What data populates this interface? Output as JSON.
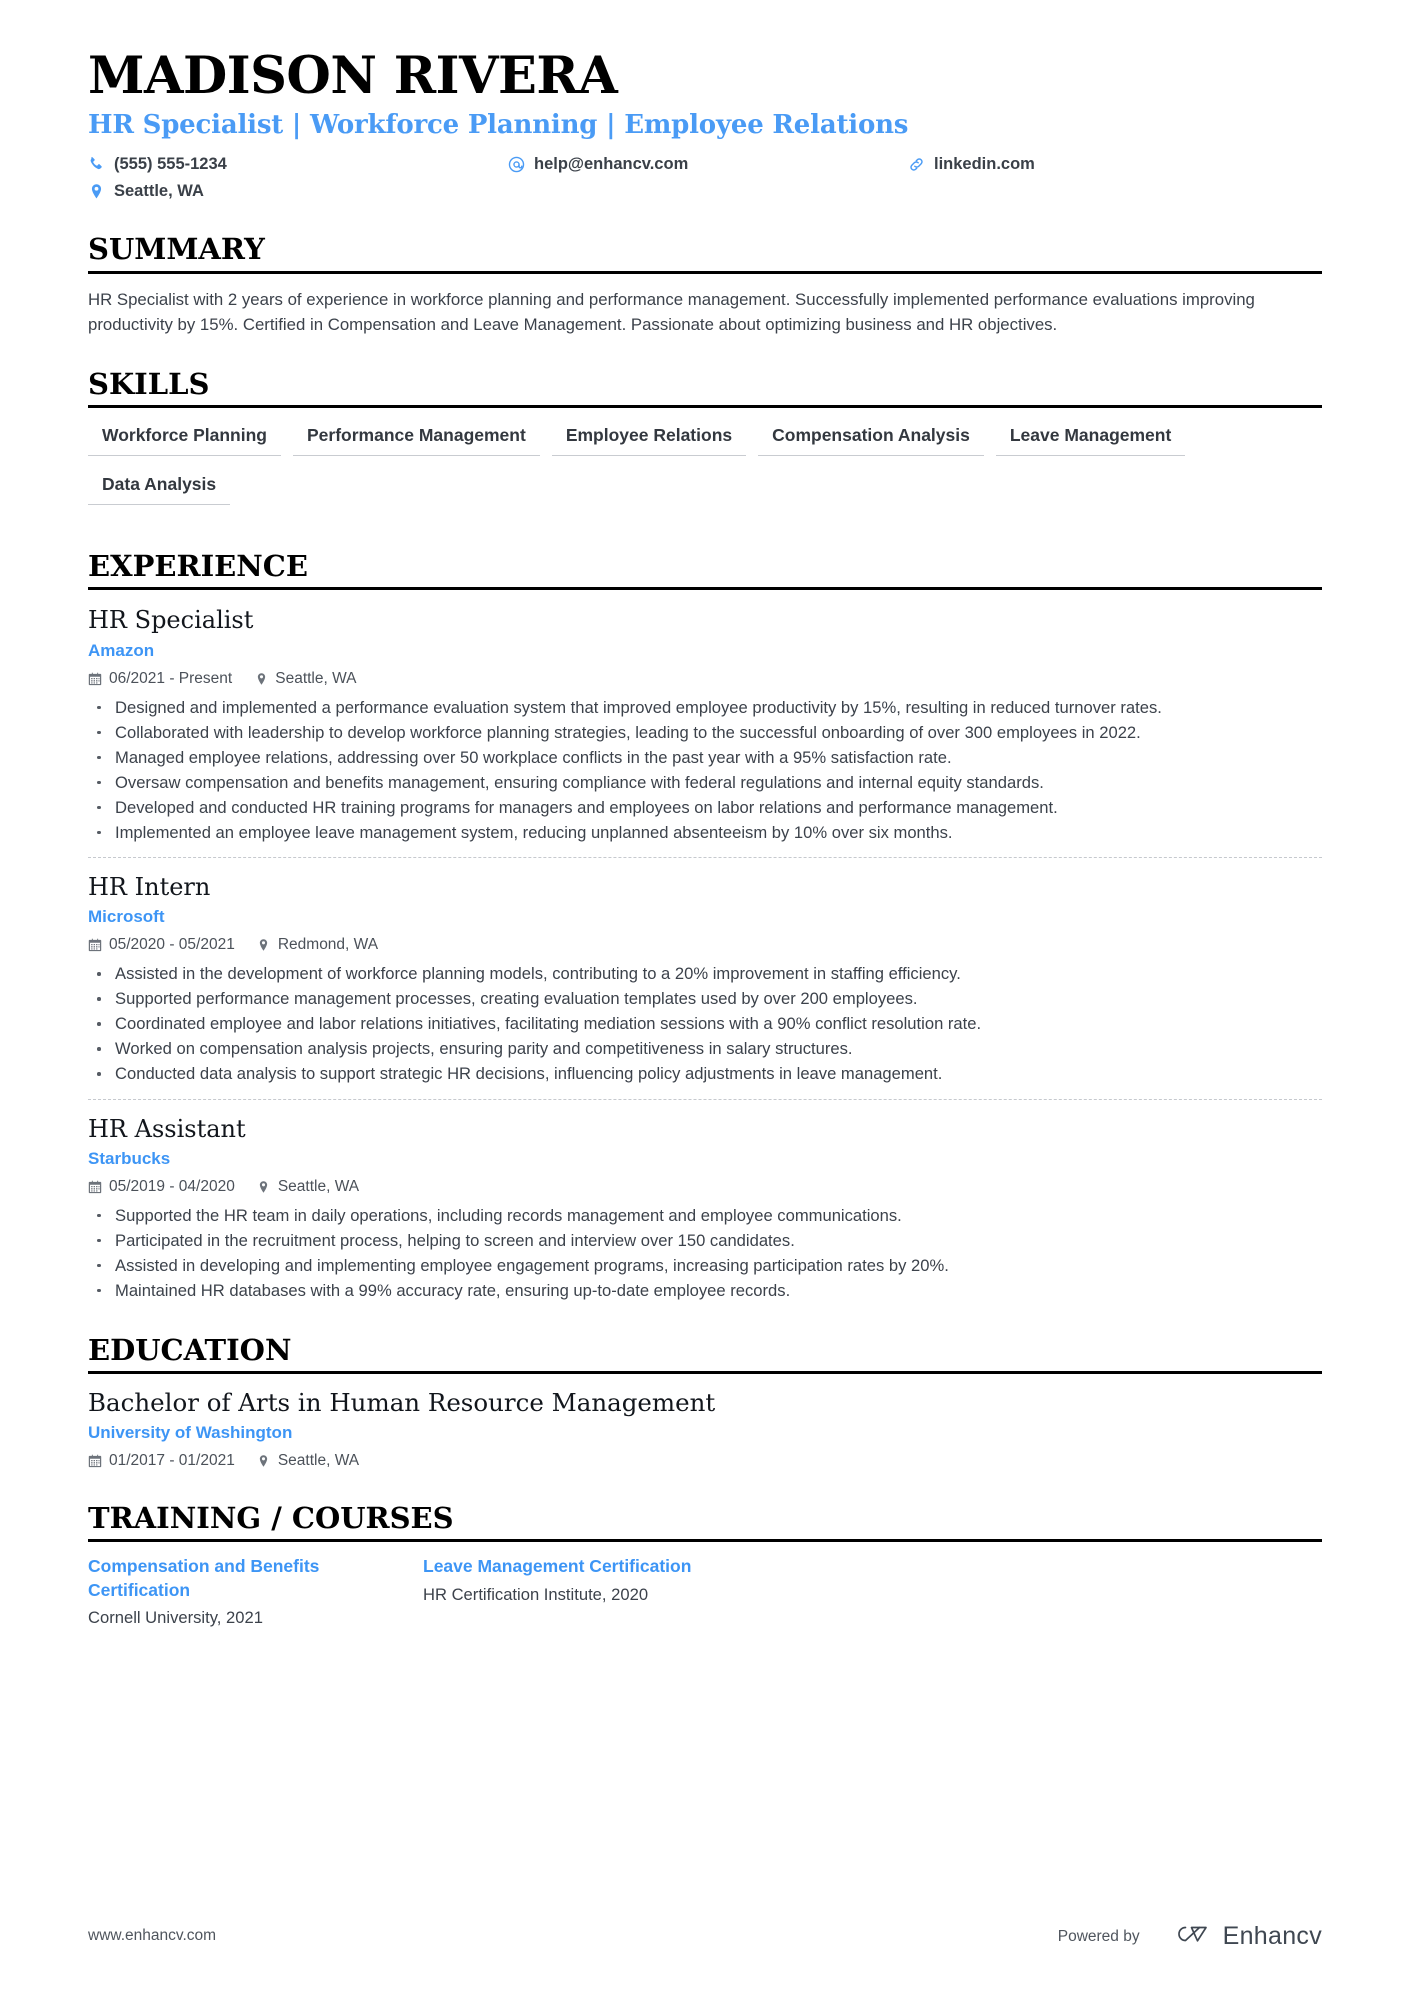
{
  "theme": {
    "accent_blue": "#3d95f5",
    "headline_blue": "#4a9bf5",
    "text": "#3c424b",
    "rule": "#000000"
  },
  "header": {
    "name": "MADISON RIVERA",
    "headline": "HR Specialist | Workforce Planning | Employee Relations",
    "contacts": [
      {
        "icon": "phone-icon",
        "text": "(555) 555-1234"
      },
      {
        "icon": "email-icon",
        "text": "help@enhancv.com"
      },
      {
        "icon": "link-icon",
        "text": "linkedin.com"
      },
      {
        "icon": "location-icon",
        "text": "Seattle, WA"
      }
    ]
  },
  "sections": {
    "summary": {
      "title": "SUMMARY",
      "text": "HR Specialist with 2 years of experience in workforce planning and performance management. Successfully implemented performance evaluations improving productivity by 15%. Certified in Compensation and Leave Management. Passionate about optimizing business and HR objectives."
    },
    "skills": {
      "title": "SKILLS",
      "items": [
        "Workforce Planning",
        "Performance Management",
        "Employee Relations",
        "Compensation Analysis",
        "Leave Management",
        "Data Analysis"
      ]
    },
    "experience": {
      "title": "EXPERIENCE",
      "jobs": [
        {
          "title": "HR Specialist",
          "company": "Amazon",
          "dates": "06/2021 - Present",
          "location": "Seattle, WA",
          "bullets": [
            "Designed and implemented a performance evaluation system that improved employee productivity by 15%, resulting in reduced turnover rates.",
            "Collaborated with leadership to develop workforce planning strategies, leading to the successful onboarding of over 300 employees in 2022.",
            "Managed employee relations, addressing over 50 workplace conflicts in the past year with a 95% satisfaction rate.",
            "Oversaw compensation and benefits management, ensuring compliance with federal regulations and internal equity standards.",
            "Developed and conducted HR training programs for managers and employees on labor relations and performance management.",
            "Implemented an employee leave management system, reducing unplanned absenteeism by 10% over six months."
          ]
        },
        {
          "title": "HR Intern",
          "company": "Microsoft",
          "dates": "05/2020 - 05/2021",
          "location": "Redmond, WA",
          "bullets": [
            "Assisted in the development of workforce planning models, contributing to a 20% improvement in staffing efficiency.",
            "Supported performance management processes, creating evaluation templates used by over 200 employees.",
            "Coordinated employee and labor relations initiatives, facilitating mediation sessions with a 90% conflict resolution rate.",
            "Worked on compensation analysis projects, ensuring parity and competitiveness in salary structures.",
            "Conducted data analysis to support strategic HR decisions, influencing policy adjustments in leave management."
          ]
        },
        {
          "title": "HR Assistant",
          "company": "Starbucks",
          "dates": "05/2019 - 04/2020",
          "location": "Seattle, WA",
          "bullets": [
            "Supported the HR team in daily operations, including records management and employee communications.",
            "Participated in the recruitment process, helping to screen and interview over 150 candidates.",
            "Assisted in developing and implementing employee engagement programs, increasing participation rates by 20%.",
            "Maintained HR databases with a 99% accuracy rate, ensuring up-to-date employee records."
          ]
        }
      ]
    },
    "education": {
      "title": "EDUCATION",
      "entries": [
        {
          "degree": "Bachelor of Arts in Human Resource Management",
          "school": "University of Washington",
          "dates": "01/2017 - 01/2021",
          "location": "Seattle, WA"
        }
      ]
    },
    "training": {
      "title": "TRAINING / COURSES",
      "courses": [
        {
          "name": "Compensation and Benefits Certification",
          "sub": "Cornell University, 2021"
        },
        {
          "name": "Leave Management Certification",
          "sub": "HR Certification Institute, 2020"
        }
      ]
    }
  },
  "footer": {
    "url": "www.enhancv.com",
    "powered_by": "Powered by",
    "brand": "Enhancv"
  }
}
